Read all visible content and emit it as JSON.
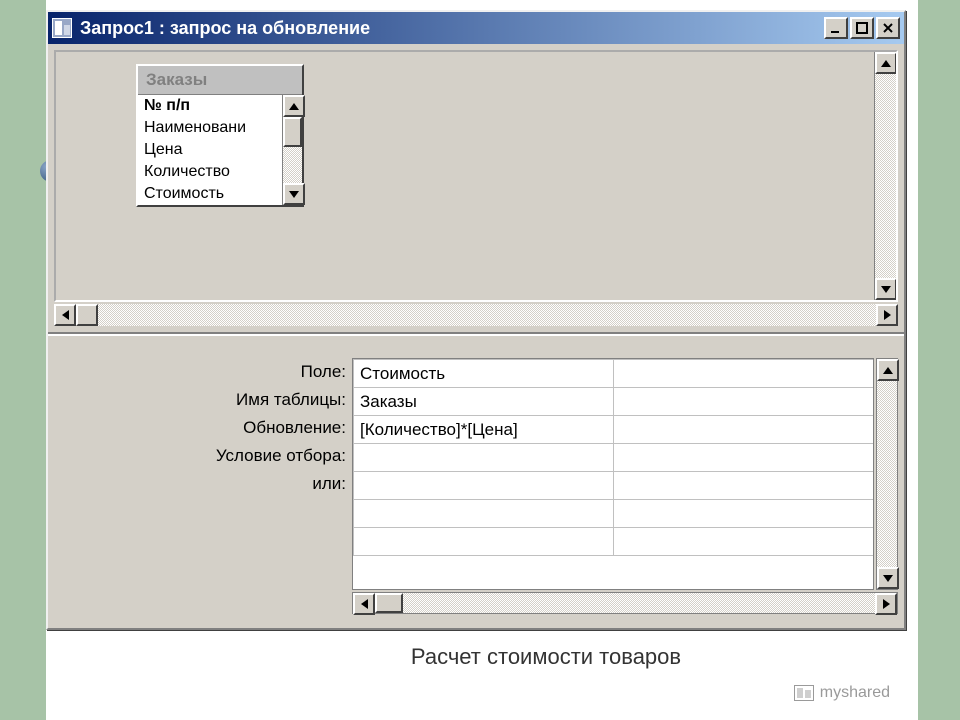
{
  "window": {
    "title": "Запрос1 : запрос на обновление"
  },
  "tablebox": {
    "title": "Заказы",
    "fields": [
      "№ п/п",
      "Наименовани",
      "Цена",
      "Количество",
      "Стоимость"
    ]
  },
  "grid": {
    "labels": [
      "Поле:",
      "Имя таблицы:",
      "Обновление:",
      "Условие отбора:",
      "или:"
    ],
    "col1": [
      "Стоимость",
      "Заказы",
      "[Количество]*[Цена]",
      "",
      ""
    ],
    "col2": [
      "",
      "",
      "",
      "",
      ""
    ]
  },
  "caption": "Расчет стоимости товаров",
  "watermark": "myshared"
}
